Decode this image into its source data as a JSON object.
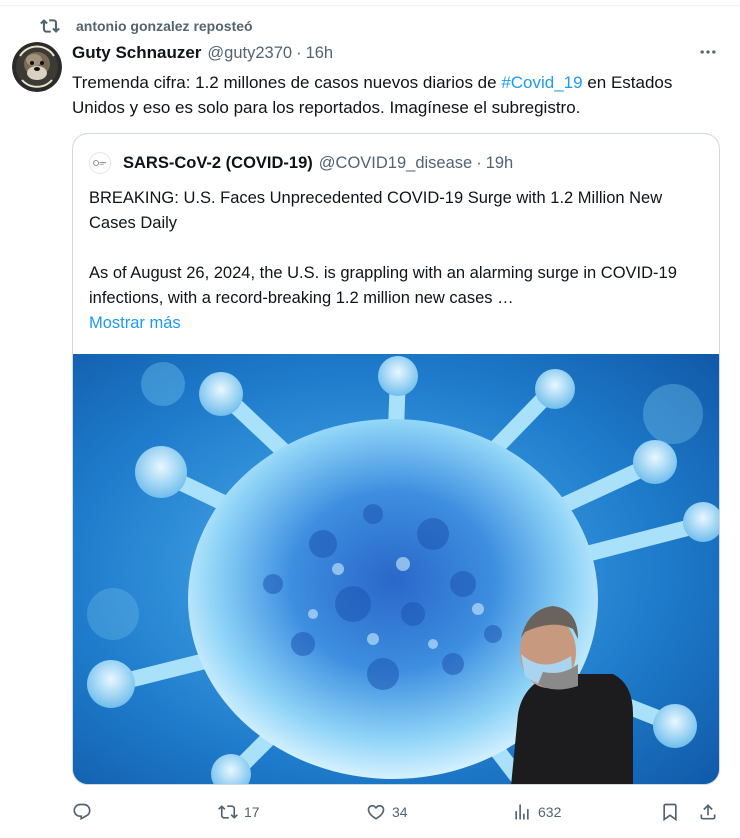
{
  "repost": {
    "text": "antonio gonzalez reposteó"
  },
  "tweet": {
    "name": "Guty Schnauzer",
    "handle": "@guty2370",
    "separator": "·",
    "time": "16h",
    "text_before": "Tremenda cifra: 1.2 millones de casos nuevos diarios de ",
    "hashtag": "#Covid_19",
    "text_after": " en Estados Unidos y eso es solo para los reportados. Imagínese el subregistro."
  },
  "quote": {
    "name": "SARS-CoV-2 (COVID-19)",
    "handle": "@COVID19_disease",
    "separator": "·",
    "time": "19h",
    "headline": "BREAKING: U.S. Faces Unprecedented COVID-19 Surge with 1.2 Million New Cases Daily",
    "body": "As of August 26, 2024, the U.S. is grappling with an alarming surge in COVID-19 infections, with a record-breaking 1.2 million new cases …",
    "show_more": "Mostrar más"
  },
  "actions": {
    "retweets": "17",
    "likes": "34",
    "views": "632"
  },
  "icons": {
    "repost": "repost-icon",
    "more": "more-icon",
    "reply": "reply-icon",
    "retweet": "retweet-icon",
    "like": "heart-icon",
    "views": "views-icon",
    "bookmark": "bookmark-icon",
    "share": "share-icon"
  },
  "colors": {
    "accent": "#1d9bf0",
    "muted": "#536471",
    "text": "#0f1419",
    "border": "#cfd9de"
  }
}
